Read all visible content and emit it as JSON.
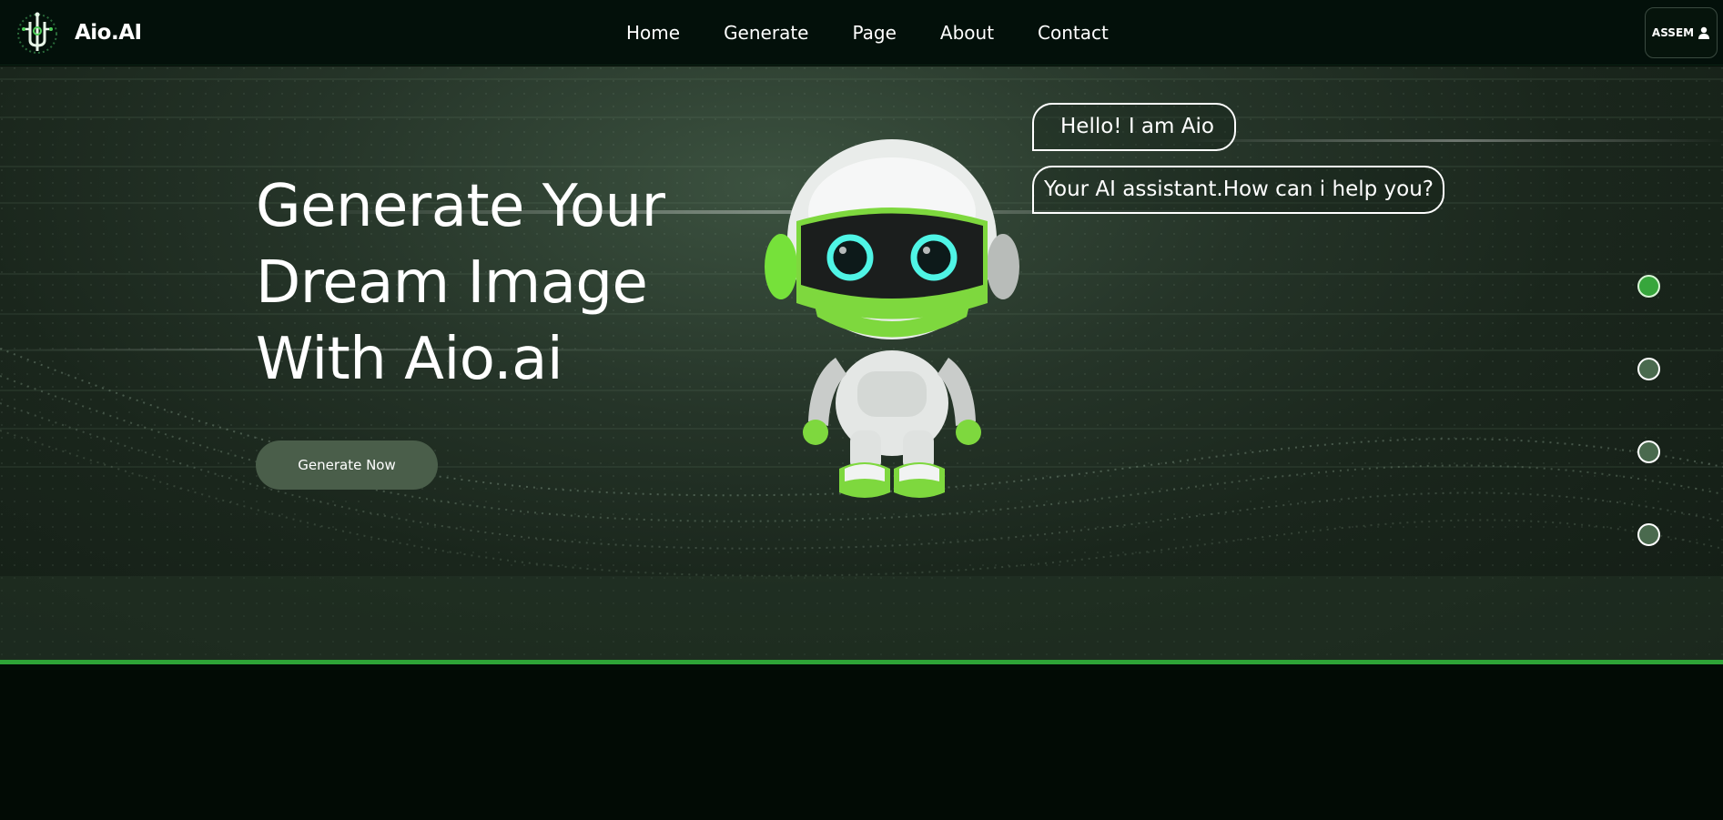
{
  "brand": {
    "name": "Aio.AI",
    "logo_icon": "chip-logo-icon"
  },
  "nav": {
    "links": [
      "Home",
      "Generate",
      "Page",
      "About",
      "Contact"
    ]
  },
  "account": {
    "label": "ASSEM",
    "icon": "user-icon"
  },
  "hero": {
    "title_lines": [
      "Generate Your",
      "Dream Image",
      "With Aio.ai"
    ],
    "cta_label": "Generate Now",
    "bubbles": [
      "Hello! I am Aio",
      "Your AI assistant.How can i help you?"
    ]
  },
  "slider": {
    "dot_count": 4,
    "active_index": 0
  },
  "colors": {
    "accent": "#37a63c",
    "nav_bg": "#03100a",
    "page_bg": "#020b05"
  }
}
